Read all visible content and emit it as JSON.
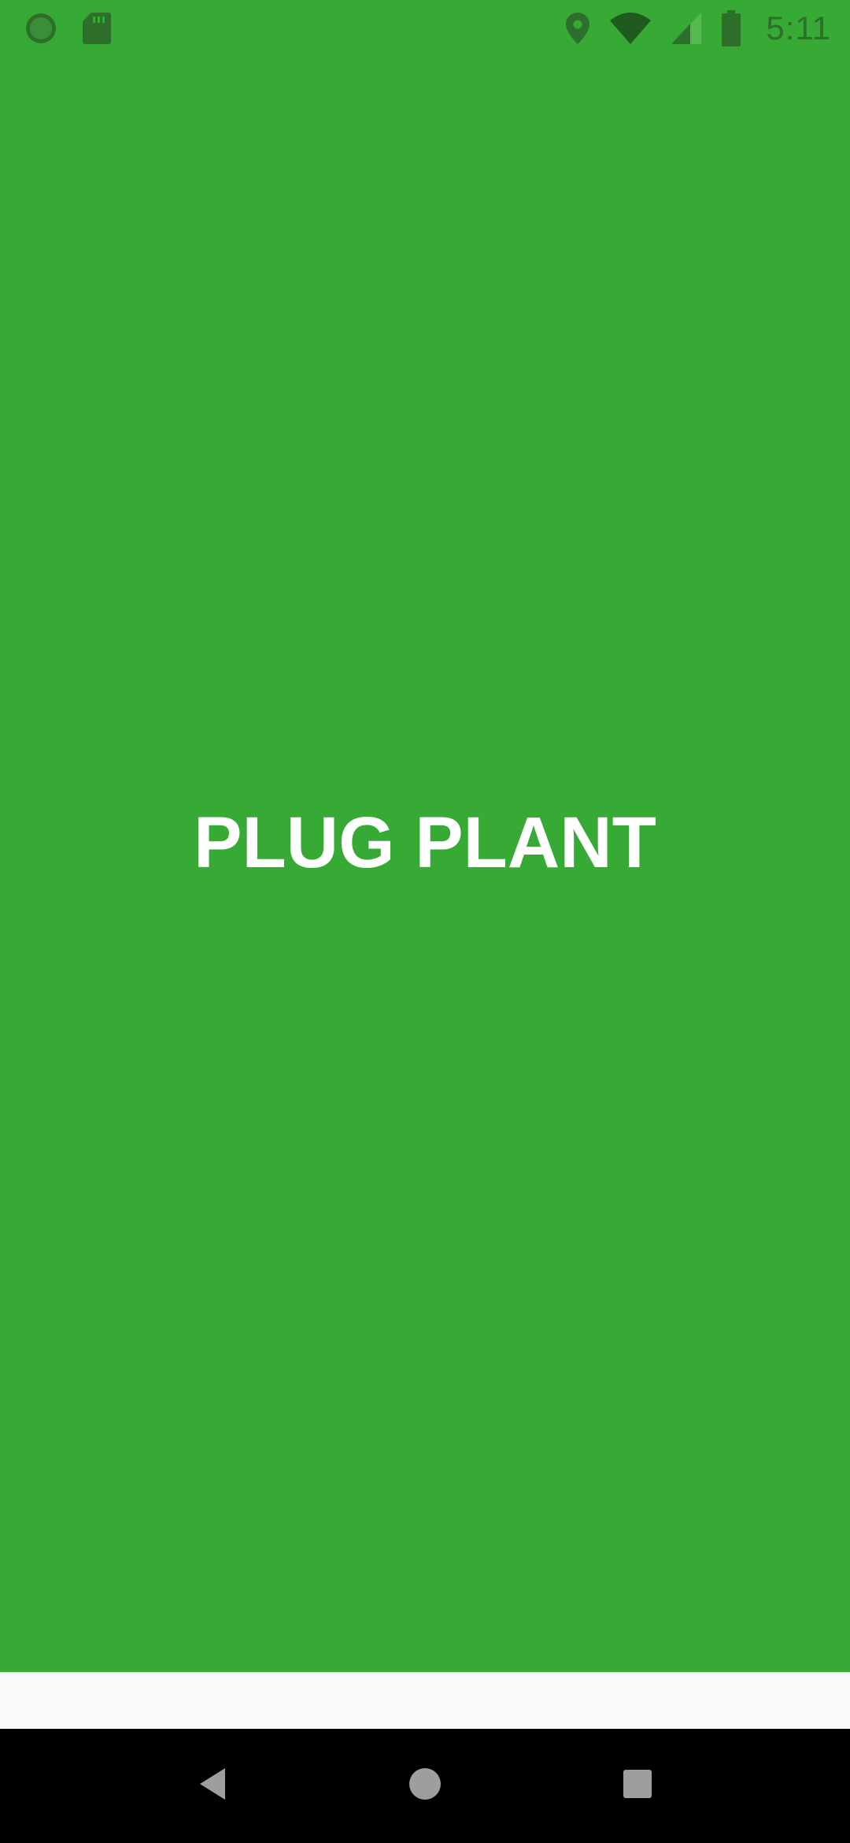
{
  "status_bar": {
    "time": "5:11",
    "icons_left": [
      "sync-icon",
      "sd-card-icon"
    ],
    "icons_right": [
      "location-icon",
      "wifi-icon",
      "signal-icon",
      "battery-icon"
    ],
    "icon_color": "#2e6f2c"
  },
  "splash": {
    "title": "PLUG PLANT",
    "background_color": "#36aa35",
    "title_color": "#ffffff"
  },
  "nav_bar": {
    "buttons": [
      "back-icon",
      "home-icon",
      "recents-icon"
    ],
    "button_color": "#9e9e9e"
  }
}
